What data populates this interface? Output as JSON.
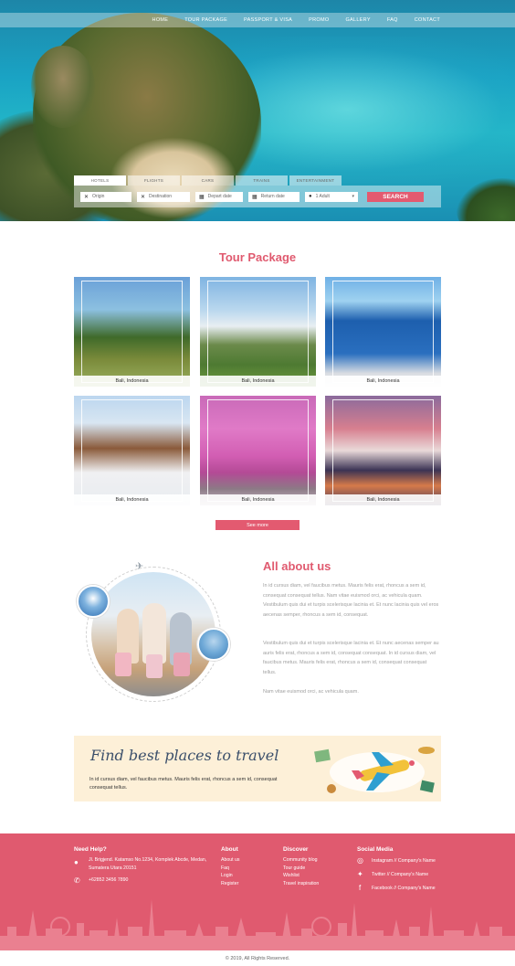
{
  "nav": {
    "items": [
      "HOME",
      "TOUR PACKAGE",
      "PASSPORT & VISA",
      "PROMO",
      "GALLERY",
      "FAQ",
      "CONTACT"
    ]
  },
  "search": {
    "tabs": [
      "HOTELS",
      "FLIGHTS",
      "CARS",
      "TRAINS",
      "ENTERTAINMENT"
    ],
    "origin": "Origin",
    "destination": "Destination",
    "depart": "Depart date",
    "return": "Return date",
    "guests": "1 Adult",
    "button": "SEARCH"
  },
  "tour": {
    "title": "Tour Package",
    "cards": [
      {
        "caption": "Bali, Indonesia"
      },
      {
        "caption": "Bali, Indonesia"
      },
      {
        "caption": "Bali, Indonesia"
      },
      {
        "caption": "Bali, Indonesia"
      },
      {
        "caption": "Bali, Indonesia"
      },
      {
        "caption": "Bali, Indonesia"
      }
    ],
    "see_more": "See more"
  },
  "about": {
    "title": "All about us",
    "p1": "In id cursus diam, vel faucibus metus. Mauris felis erat, rhoncus a sem id, consequat consequat tellus. Nam vitae euismod orci, ac vehicula quam. Vestibulum quis dui et turpis scelerisque lacinia et. Et nunc lacinia quis vel eros aecenas semper, rhoncus a sem id, consequat.",
    "p2": "Vestibulum quis dui et turpis scelerisque lacinia et. Et nunc aecenas semper au auris felis erat, rhoncus a sem id, consequat consequat. In id cursus diam, vel faucibus metus. Mauris felis erat, rhoncus a sem id, consequat consequat tellus.",
    "p3": "Nam vitae euismod orci, ac vehicula quam."
  },
  "banner": {
    "title": "Find best places to travel",
    "text": "In id cursus diam, vel faucibus metus. Mauris felis erat, rhoncus a sem id, consequat consequat tellus."
  },
  "footer": {
    "help_title": "Need Help?",
    "address": "Jl. Brigjend. Katamso No.1234, Komplek Abcde, Medan, Sumatera Utara 20151",
    "phone": "+62852 3456 7890",
    "about_title": "About",
    "about_links": [
      "About us",
      "Faq",
      "Login",
      "Register"
    ],
    "discover_title": "Discover",
    "discover_links": [
      "Community blog",
      "Tour guide",
      "Wishlist",
      "Travel inspiration"
    ],
    "social_title": "Social Media",
    "social_links": [
      "Instagram // Company's Name",
      "Twitter // Company's Name",
      "Facebook // Company's Name"
    ],
    "copyright": "© 2019, All Rights Reserved."
  },
  "colors": {
    "accent": "#e35a70",
    "footer_bg": "#e05a6f",
    "banner_bg": "#fdf0d8"
  }
}
